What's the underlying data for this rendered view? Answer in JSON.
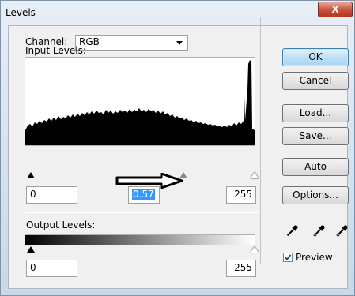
{
  "window": {
    "title": "Levels",
    "close_label": "X"
  },
  "channel": {
    "label": "Channel:",
    "value": "RGB"
  },
  "input_levels": {
    "label": "Input Levels:",
    "black": "0",
    "gamma": "0.57",
    "white": "255"
  },
  "output_levels": {
    "label": "Output Levels:",
    "black": "0",
    "white": "255"
  },
  "buttons": {
    "ok": "OK",
    "cancel": "Cancel",
    "load": "Load...",
    "save": "Save...",
    "auto": "Auto",
    "options": "Options..."
  },
  "preview": {
    "label": "Preview",
    "checked": true
  },
  "icons": [
    "close-icon",
    "dropdown-arrow-icon",
    "black-eyedropper-icon",
    "gray-eyedropper-icon",
    "white-eyedropper-icon",
    "checkmark-icon",
    "right-arrow-annotation"
  ],
  "colors": {
    "window_bg": "#f0f0f0",
    "close_red": "#c7503a",
    "selection": "#3399ff",
    "default_button": "#bfe0f6"
  }
}
